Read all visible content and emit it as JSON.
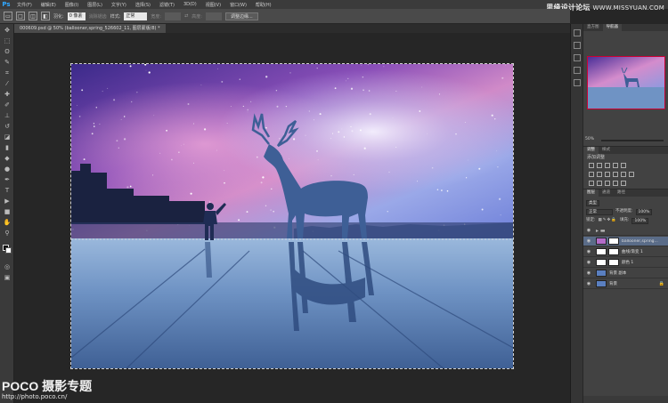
{
  "app": {
    "logo": "Ps",
    "menu": [
      "文件(F)",
      "编辑(E)",
      "图像(I)",
      "图层(L)",
      "文字(Y)",
      "选择(S)",
      "滤镜(T)",
      "3D(D)",
      "视图(V)",
      "窗口(W)",
      "帮助(H)"
    ]
  },
  "watermark": {
    "text": "思缘设计论坛",
    "url": "WWW.MISSYUAN.COM"
  },
  "options_bar": {
    "feather_label": "羽化:",
    "feather_value": "0 像素",
    "antialias_label": "消除锯齿",
    "style_label": "样式:",
    "style_value": "正常",
    "width_label": "宽度:",
    "height_label": "高度:",
    "refine_edge_button": "调整边缘..."
  },
  "document_tab": {
    "title": "000609.psd @ 50% (ballooner,spring_526602_11, 图层蒙版/8) *"
  },
  "credit": {
    "logo": "POCO 摄影专题",
    "url": "http://photo.poco.cn/"
  },
  "navigator": {
    "tabs": [
      "直方图",
      "导航器"
    ],
    "active_tab": 1,
    "zoom": "50%"
  },
  "adjustments": {
    "tabs": [
      "调整",
      "样式"
    ],
    "title": "添加调整"
  },
  "layers": {
    "tabs": [
      "图层",
      "通道",
      "路径"
    ],
    "kind_label": "类型",
    "blend_mode": "正常",
    "opacity_label": "不透明度:",
    "opacity_value": "100%",
    "lock_label": "锁定:",
    "fill_label": "填充:",
    "fill_value": "100%",
    "items": [
      {
        "name": "",
        "type": "group",
        "selected": false
      },
      {
        "name": "ballooner,spring...",
        "type": "image-mask",
        "selected": true
      },
      {
        "name": "曲线/渐变 1",
        "type": "adjustment-mask",
        "selected": false
      },
      {
        "name": "颜色 1",
        "type": "adjustment-mask",
        "selected": false
      },
      {
        "name": "背景 副本",
        "type": "image",
        "selected": false
      },
      {
        "name": "背景",
        "type": "image-locked",
        "selected": false
      }
    ]
  },
  "colors": {
    "accent": "#31a8ff",
    "selected_layer": "#5a6c88",
    "panel_bg": "#424242",
    "canvas_bg": "#262626"
  }
}
